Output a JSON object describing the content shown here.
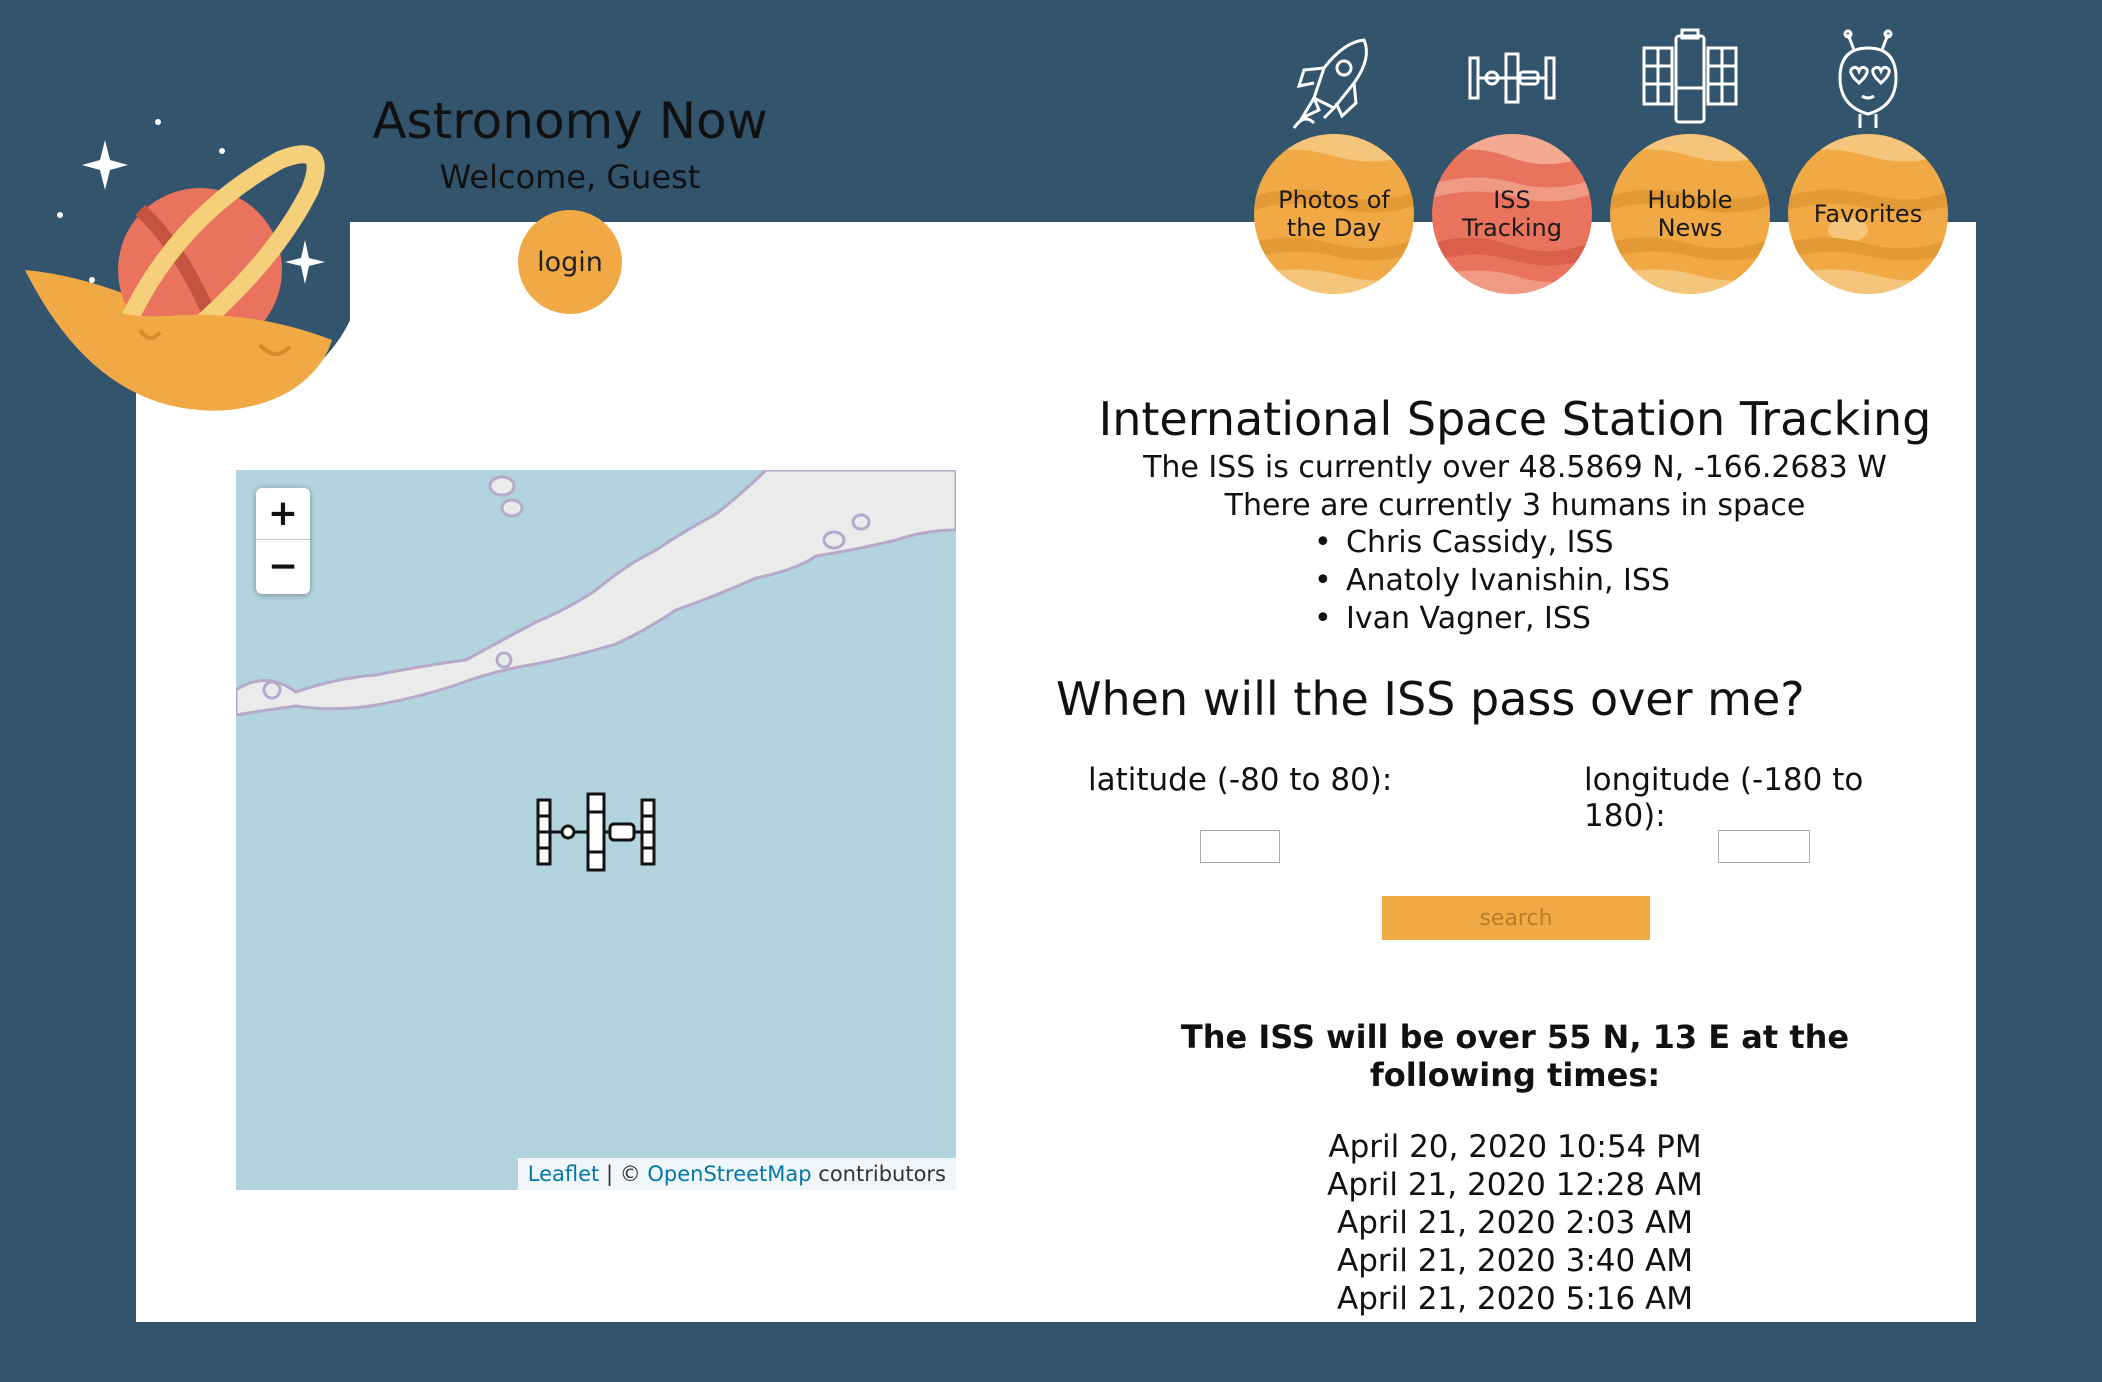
{
  "header": {
    "title": "Astronomy Now",
    "welcome": "Welcome, Guest",
    "login_label": "login"
  },
  "nav": {
    "items": [
      {
        "label": "Photos of the Day",
        "icon": "rocket-icon"
      },
      {
        "label": "ISS Tracking",
        "icon": "space-station-icon"
      },
      {
        "label": "Hubble News",
        "icon": "hubble-telescope-icon"
      },
      {
        "label": "Favorites",
        "icon": "alien-icon"
      }
    ]
  },
  "map": {
    "zoom_in": "+",
    "zoom_out": "−",
    "attribution_leaflet": "Leaflet",
    "attribution_sep": " | © ",
    "attribution_osm": "OpenStreetMap",
    "attribution_suffix": " contributors"
  },
  "info": {
    "title": "International Space Station Tracking",
    "position": "The ISS is currently over 48.5869 N, -166.2683 W",
    "humans": "There are currently 3 humans in space",
    "astronauts": [
      "Chris Cassidy, ISS",
      "Anatoly Ivanishin, ISS",
      "Ivan Vagner, ISS"
    ]
  },
  "pass": {
    "title": "When will the ISS pass over me?",
    "lat_label": "latitude (-80 to 80):",
    "lon_label": "longitude (-180 to 180):",
    "lat_value": "",
    "lon_value": "",
    "search_label": "search",
    "result_title": "The ISS will be over 55 N, 13 E at the following times:",
    "times": [
      "April 20, 2020 10:54 PM",
      "April 21, 2020 12:28 AM",
      "April 21, 2020 2:03 AM",
      "April 21, 2020 3:40 AM",
      "April 21, 2020 5:16 AM"
    ]
  },
  "colors": {
    "background": "#33546d",
    "accent_orange": "#f0a944",
    "accent_coral": "#e9735d",
    "map_water": "#b3d3de"
  }
}
